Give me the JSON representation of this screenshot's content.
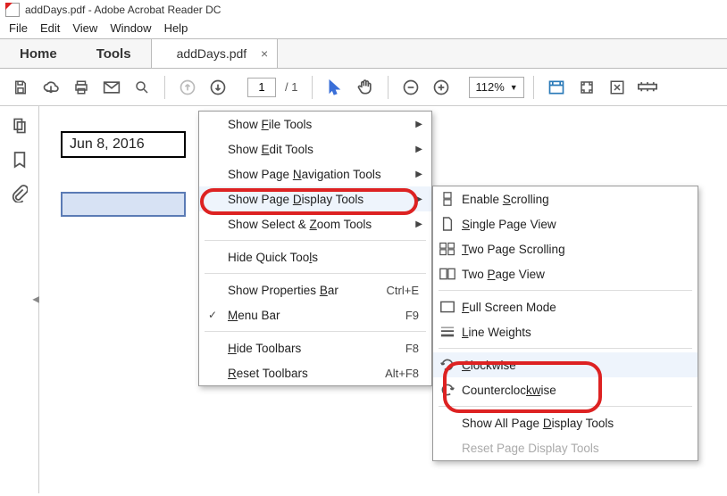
{
  "titlebar": {
    "text": "addDays.pdf - Adobe Acrobat Reader DC"
  },
  "menubar": {
    "items": [
      "File",
      "Edit",
      "View",
      "Window",
      "Help"
    ]
  },
  "tabs": {
    "home": "Home",
    "tools": "Tools",
    "file": "addDays.pdf"
  },
  "toolbar": {
    "page_current": "1",
    "page_total": "/  1",
    "zoom": "112%"
  },
  "document": {
    "date_text": "Jun 8, 2016"
  },
  "context_menu": {
    "items": [
      {
        "label_pre": "Show ",
        "u": "F",
        "label_post": "ile Tools",
        "submenu": true
      },
      {
        "label_pre": "Show ",
        "u": "E",
        "label_post": "dit Tools",
        "submenu": true
      },
      {
        "label_pre": "Show Page ",
        "u": "N",
        "label_post": "avigation Tools",
        "submenu": true
      },
      {
        "label_pre": "Show Page ",
        "u": "D",
        "label_post": "isplay Tools",
        "submenu": true,
        "highlight": true
      },
      {
        "label_pre": "Show Select & ",
        "u": "Z",
        "label_post": "oom Tools",
        "submenu": true
      }
    ],
    "hide_quick": {
      "pre": "Hide Quick Too",
      "u": "l",
      "post": "s"
    },
    "props_bar": {
      "pre": "Show Properties ",
      "u": "B",
      "post": "ar",
      "accel": "Ctrl+E"
    },
    "menu_bar": {
      "pre": "",
      "u": "M",
      "post": "enu Bar",
      "accel": "F9",
      "checked": true
    },
    "hide_tool": {
      "pre": "",
      "u": "H",
      "post": "ide Toolbars",
      "accel": "F8"
    },
    "reset_tool": {
      "pre": "",
      "u": "R",
      "post": "eset Toolbars",
      "accel": "Alt+F8"
    }
  },
  "submenu": {
    "enable_scrolling": {
      "pre": "Enable ",
      "u": "S",
      "post": "crolling"
    },
    "single_page": {
      "pre": "",
      "u": "S",
      "post": "ingle Page View"
    },
    "two_scroll": {
      "pre": "",
      "u": "T",
      "post": "wo Page Scrolling"
    },
    "two_page": {
      "pre": "Two ",
      "u": "P",
      "post": "age View"
    },
    "full_screen": {
      "pre": "",
      "u": "F",
      "post": "ull Screen Mode"
    },
    "line_weights": {
      "pre": "",
      "u": "L",
      "post": "ine Weights"
    },
    "clockwise": {
      "pre": "",
      "u": "C",
      "post": "lockwise"
    },
    "ccw": {
      "pre": "Countercloc",
      "u": "kw",
      "post": "ise"
    },
    "show_all": {
      "pre": "Show All Page ",
      "u": "D",
      "post": "isplay Tools"
    },
    "reset": {
      "pre": "Reset Pa",
      "u": "g",
      "post": "e Display Tools"
    }
  }
}
